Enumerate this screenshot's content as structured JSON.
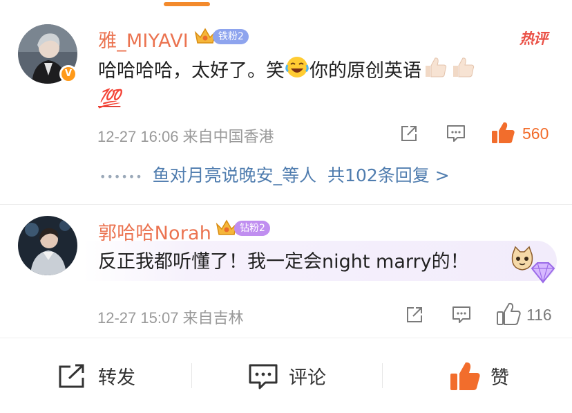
{
  "comments": [
    {
      "username": "雅_MIYAVI",
      "fan_badge": "铁粉2",
      "hot_tag": "热评",
      "text_part1": "哈哈哈哈，太好了。笑",
      "text_part2": "你的原创英语",
      "emoji_line2": "💯",
      "time_location": "12-27 16:06  来自中国香港",
      "like_count": "560",
      "reply_preview": "鱼对月亮说晚安_等人",
      "reply_count": "共102条回复 >",
      "colors": {
        "like_active": "#f26d2c",
        "username": "#eb7350",
        "reply": "#507daf"
      }
    },
    {
      "username": "郭哈哈Norah",
      "fan_badge": "钻粉2",
      "text": "反正我都听懂了！我一定会night marry的！",
      "time_location": "12-27 15:07  来自吉林",
      "like_count": "116"
    }
  ],
  "bottom_bar": {
    "forward_label": "转发",
    "comment_label": "评论",
    "like_label": "赞"
  },
  "icons": [
    "share-icon",
    "comment-icon",
    "thumbs-up-icon",
    "verified-badge-icon",
    "crown-icon",
    "cat-sticker-icon",
    "diamond-icon"
  ]
}
